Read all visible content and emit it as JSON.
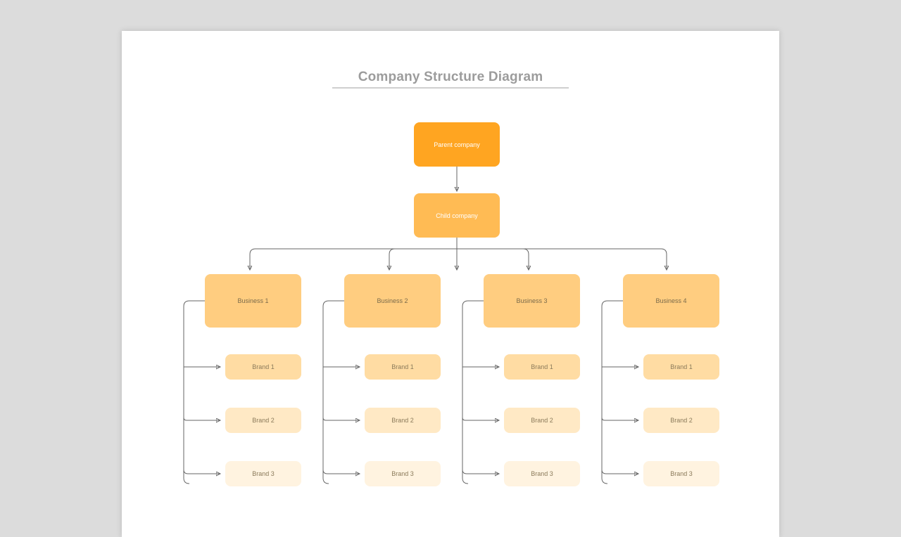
{
  "title": "Company Structure Diagram",
  "nodes": {
    "parent": "Parent company",
    "child": "Child company",
    "businesses": [
      {
        "name": "Business 1",
        "brands": [
          "Brand 1",
          "Brand 2",
          "Brand 3"
        ]
      },
      {
        "name": "Business 2",
        "brands": [
          "Brand 1",
          "Brand 2",
          "Brand 3"
        ]
      },
      {
        "name": "Business 3",
        "brands": [
          "Brand 1",
          "Brand 2",
          "Brand 3"
        ]
      },
      {
        "name": "Business 4",
        "brands": [
          "Brand 1",
          "Brand 2",
          "Brand 3"
        ]
      }
    ]
  },
  "chart_data": {
    "type": "tree",
    "title": "Company Structure Diagram",
    "root": {
      "label": "Parent company",
      "children": [
        {
          "label": "Child company",
          "children": [
            {
              "label": "Business 1",
              "children": [
                {
                  "label": "Brand 1"
                },
                {
                  "label": "Brand 2"
                },
                {
                  "label": "Brand 3"
                }
              ]
            },
            {
              "label": "Business 2",
              "children": [
                {
                  "label": "Brand 1"
                },
                {
                  "label": "Brand 2"
                },
                {
                  "label": "Brand 3"
                }
              ]
            },
            {
              "label": "Business 3",
              "children": [
                {
                  "label": "Brand 1"
                },
                {
                  "label": "Brand 2"
                },
                {
                  "label": "Brand 3"
                }
              ]
            },
            {
              "label": "Business 4",
              "children": [
                {
                  "label": "Brand 1"
                },
                {
                  "label": "Brand 2"
                },
                {
                  "label": "Brand 3"
                }
              ]
            }
          ]
        }
      ]
    }
  }
}
